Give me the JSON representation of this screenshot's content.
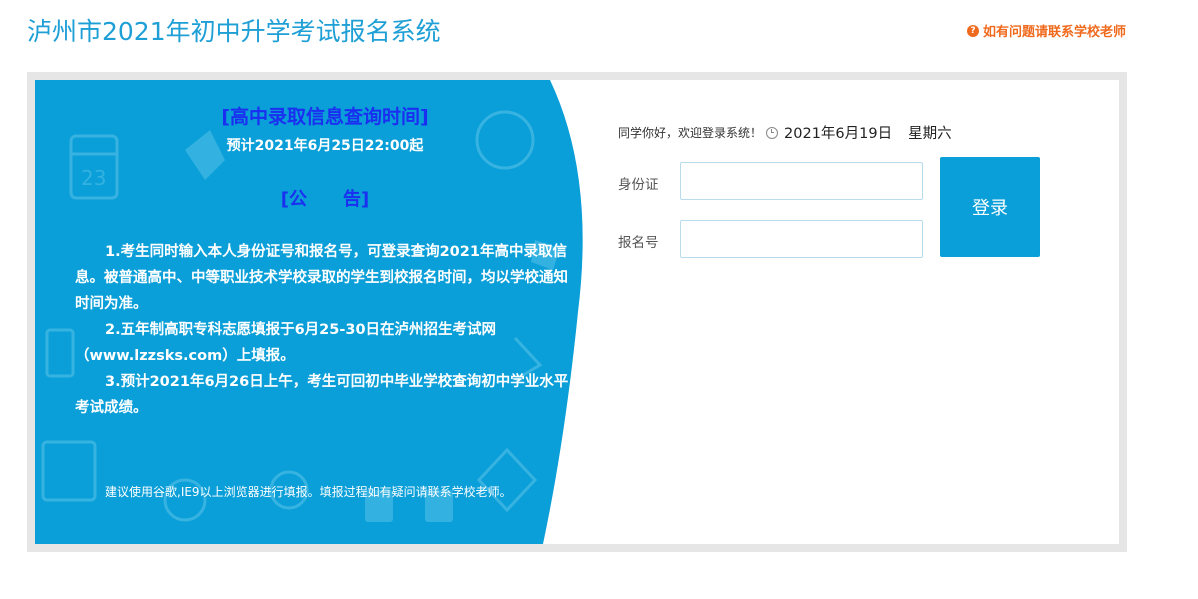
{
  "header": {
    "title": "泸州市2021年初中升学考试报名系统",
    "help_text": "如有问题请联系学校老师",
    "help_icon": "question-circle-icon"
  },
  "notice": {
    "time_title": "[高中录取信息查询时间]",
    "time_subtitle": "预计2021年6月25日22:00起",
    "heading": "[公　　告]",
    "items": [
      "1.考生同时输入本人身份证号和报名号，可登录查询2021年高中录取信息。被普通高中、中等职业技术学校录取的学生到校报名时间，均以学校通知时间为准。",
      "2.五年制高职专科志愿填报于6月25-30日在泸州招生考试网（www.lzzsks.com）上填报。",
      "3.预计2021年6月26日上午，考生可回初中毕业学校查询初中学业水平考试成绩。"
    ],
    "footer": "建议使用谷歌,IE9以上浏览器进行填报。填报过程如有疑问请联系学校老师。"
  },
  "login": {
    "welcome": "同学你好，欢迎登录系统！",
    "date": "2021年6月19日",
    "weekday": "星期六",
    "id_label": "身份证",
    "id_value": "",
    "reg_label": "报名号",
    "reg_value": "",
    "button_label": "登录"
  },
  "colors": {
    "brand_blue": "#1e9fd6",
    "panel_blue": "#0a9fd8",
    "help_orange": "#f06a1d",
    "highlight_blue": "#1a2ff0"
  }
}
